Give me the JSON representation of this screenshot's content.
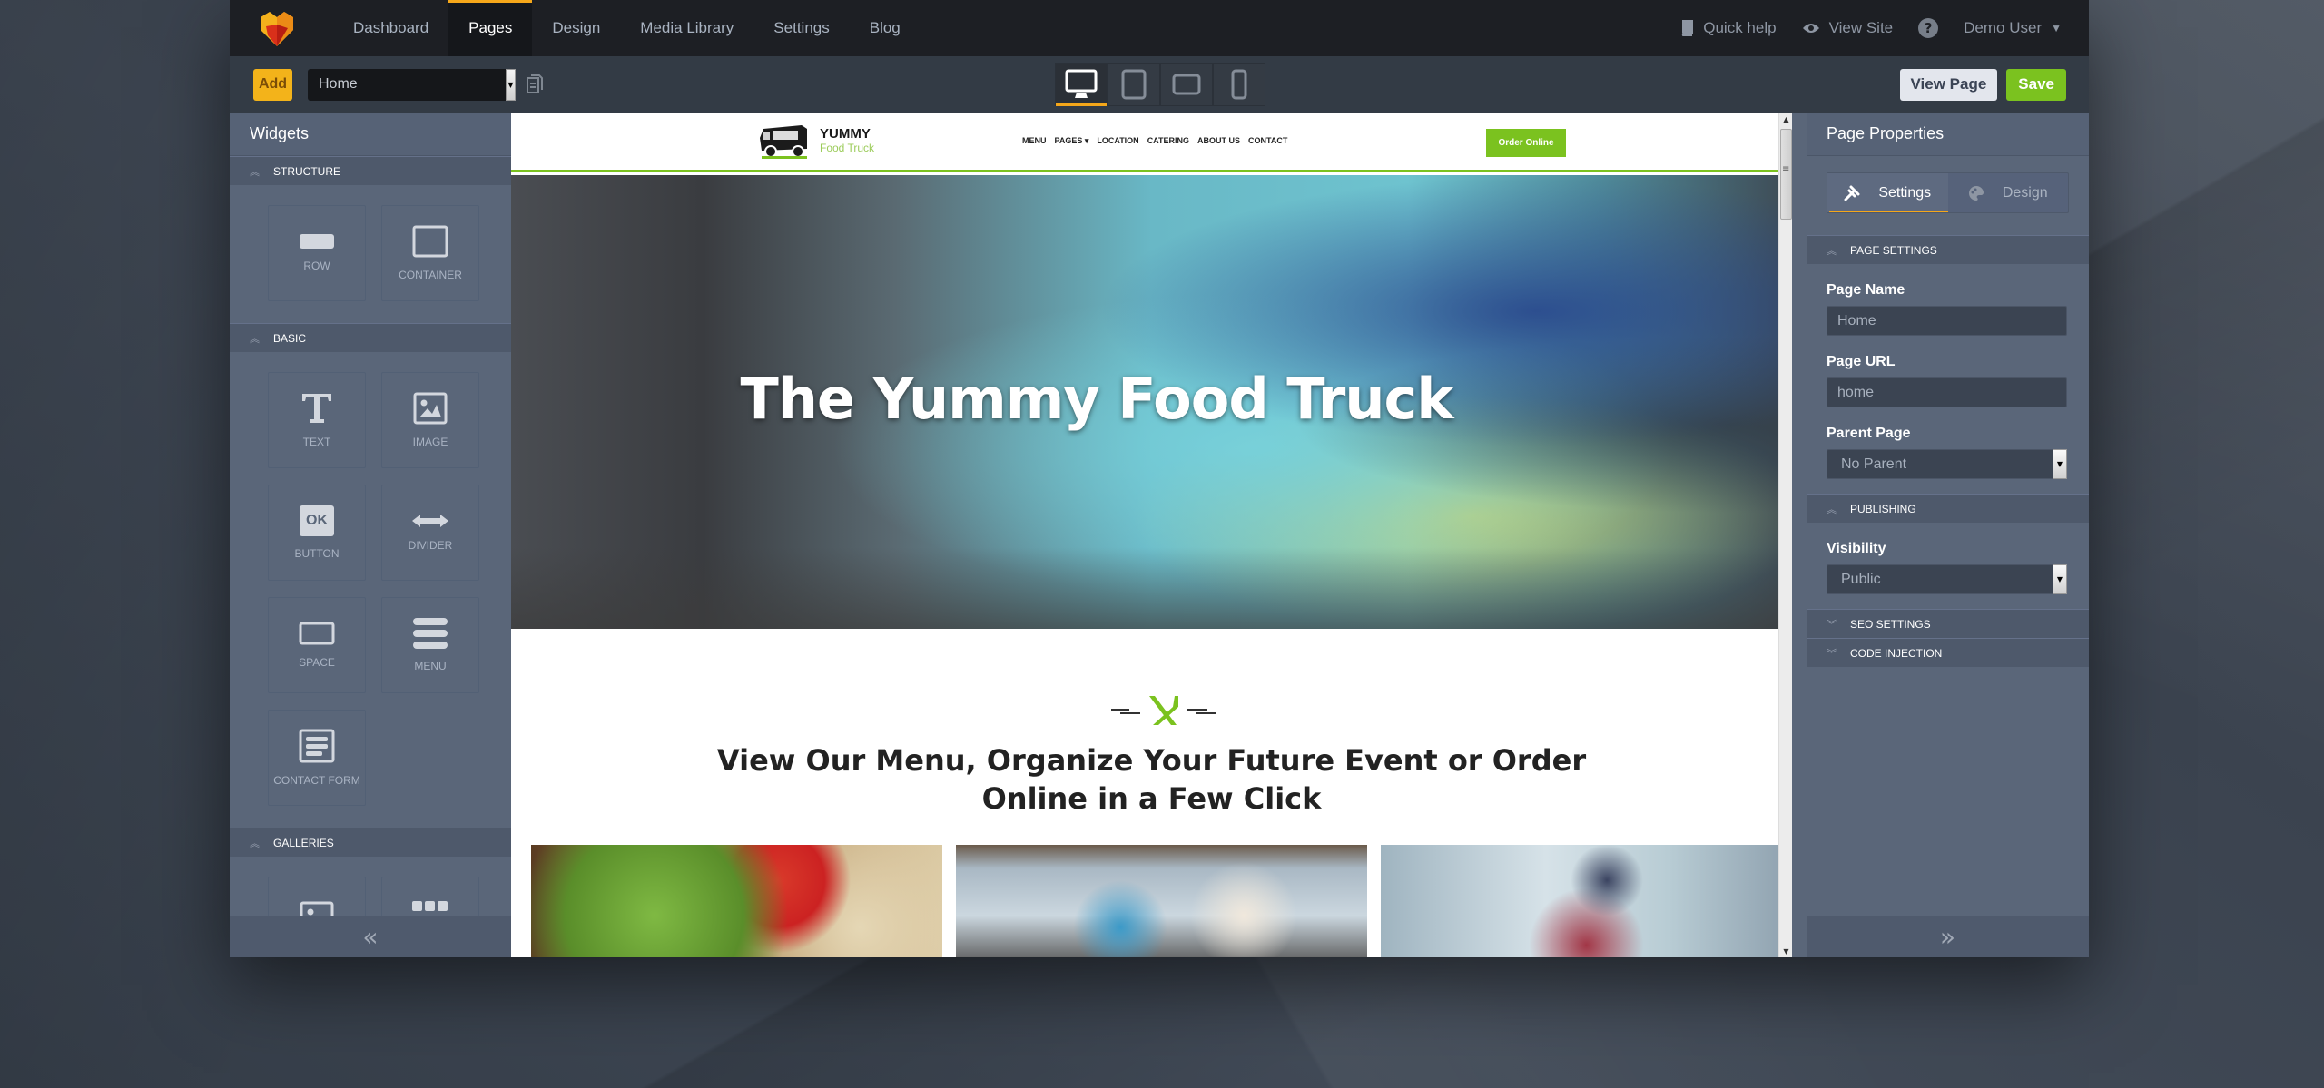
{
  "topnav": {
    "logo": "hexagon-heart-logo",
    "items": [
      {
        "label": "Dashboard",
        "active": false
      },
      {
        "label": "Pages",
        "active": true
      },
      {
        "label": "Design",
        "active": false
      },
      {
        "label": "Media Library",
        "active": false
      },
      {
        "label": "Settings",
        "active": false
      },
      {
        "label": "Blog",
        "active": false
      }
    ],
    "quick_help": "Quick help",
    "view_site": "View Site",
    "help_icon": "?",
    "user": "Demo User"
  },
  "toolbar": {
    "add_label": "Add",
    "page_select_value": "Home",
    "devices": [
      {
        "name": "desktop",
        "active": true
      },
      {
        "name": "tablet-portrait",
        "active": false
      },
      {
        "name": "tablet-landscape",
        "active": false
      },
      {
        "name": "phone",
        "active": false
      }
    ],
    "view_page_label": "View Page",
    "save_label": "Save"
  },
  "widgets_panel": {
    "title": "Widgets",
    "sections": [
      {
        "title": "STRUCTURE",
        "items": [
          "ROW",
          "CONTAINER"
        ]
      },
      {
        "title": "BASIC",
        "items": [
          "TEXT",
          "IMAGE",
          "BUTTON",
          "DIVIDER",
          "SPACE",
          "MENU",
          "CONTACT FORM"
        ]
      },
      {
        "title": "GALLERIES",
        "items": []
      }
    ],
    "button_icon_text": "OK",
    "collapse_icon": "«"
  },
  "site": {
    "brand_top": "YUMMY",
    "brand_bottom": "Food Truck",
    "nav": [
      "MENU",
      "PAGES ▾",
      "LOCATION",
      "CATERING",
      "ABOUT US",
      "CONTACT"
    ],
    "order_button": "Order Online",
    "hero_title": "The Yummy Food Truck",
    "menu_heading_line1": "View Our Menu, Organize Your Future Event or Order",
    "menu_heading_line2": "Online in a Few Click",
    "accent_color": "#7bc21f"
  },
  "properties_panel": {
    "title": "Page Properties",
    "tabs": [
      {
        "label": "Settings",
        "active": true
      },
      {
        "label": "Design",
        "active": false
      }
    ],
    "sections": {
      "page_settings": "PAGE SETTINGS",
      "publishing": "PUBLISHING",
      "seo_settings": "SEO SETTINGS",
      "code_injection": "CODE INJECTION"
    },
    "fields": {
      "page_name_label": "Page Name",
      "page_name_value": "Home",
      "page_url_label": "Page URL",
      "page_url_value": "home",
      "parent_page_label": "Parent Page",
      "parent_page_value": "No Parent",
      "visibility_label": "Visibility",
      "visibility_value": "Public"
    },
    "collapse_icon": "»"
  }
}
